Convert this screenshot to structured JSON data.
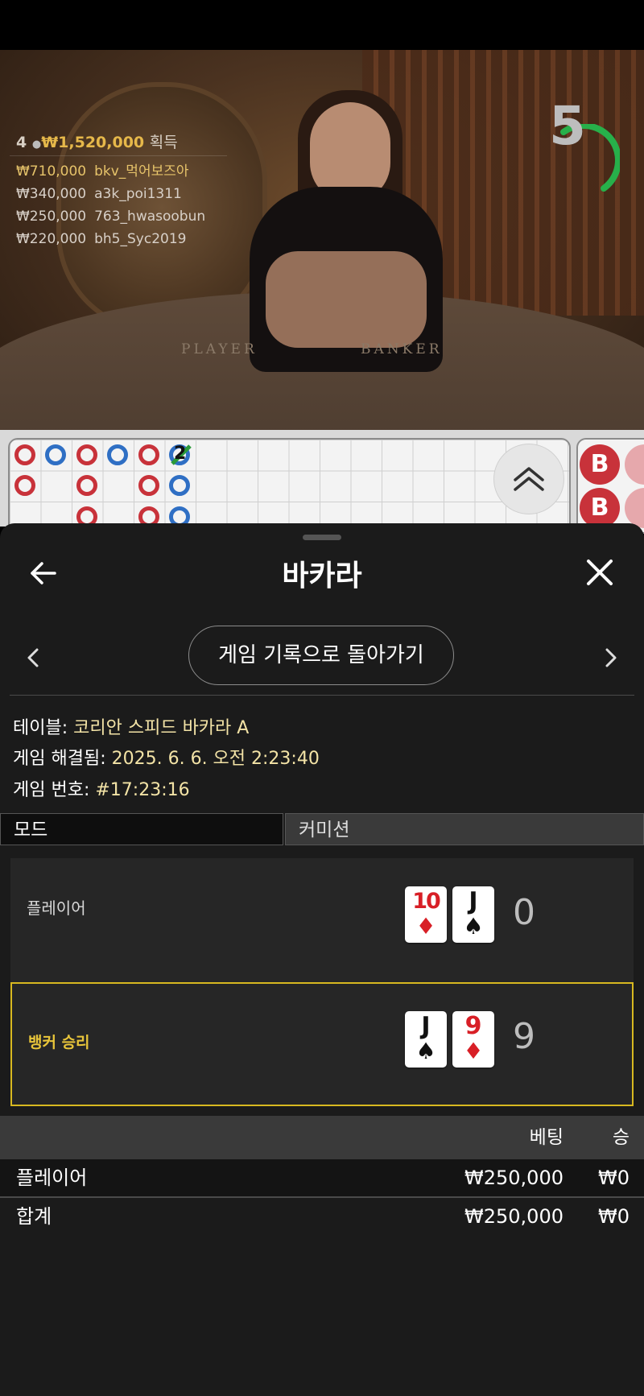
{
  "video": {
    "leaderboard": {
      "winner_count": "4",
      "total_amount": "₩1,520,000",
      "won_label": "획득",
      "rows": [
        {
          "amount": "₩710,000",
          "user": "bkv_먹어보즈아"
        },
        {
          "amount": "₩340,000",
          "user": "a3k_poi1311"
        },
        {
          "amount": "₩250,000",
          "user": "763_hwasoobun"
        },
        {
          "amount": "₩220,000",
          "user": "bh5_Syc2019"
        }
      ]
    },
    "timer": "5",
    "felt_player": "PLAYER",
    "felt_banker": "BANKER"
  },
  "roadmap": {
    "tie_count": "2",
    "side_bead": "B"
  },
  "sheet": {
    "title": "바카라",
    "back_to_history": "게임 기록으로 돌아가기",
    "table_label": "테이블:",
    "table_value": "코리안 스피드 바카라 A",
    "resolved_label": "게임 해결됨:",
    "resolved_value": "2025. 6. 6. 오전 2:23:40",
    "game_no_label": "게임 번호:",
    "game_no_value": "#17:23:16",
    "mode_label": "모드",
    "mode_value": "커미션",
    "player": {
      "label": "플레이어",
      "cards": [
        {
          "rank": "10",
          "suit": "♦"
        },
        {
          "rank": "J",
          "suit": "♠"
        }
      ],
      "score": "0"
    },
    "banker": {
      "label": "뱅커 승리",
      "cards": [
        {
          "rank": "J",
          "suit": "♠"
        },
        {
          "rank": "9",
          "suit": "♦"
        }
      ],
      "score": "9"
    },
    "bets": {
      "header_bet": "베팅",
      "header_win": "승",
      "rows": [
        {
          "name": "플레이어",
          "bet": "₩250,000",
          "win": "₩0"
        },
        {
          "name": "합계",
          "bet": "₩250,000",
          "win": "₩0"
        }
      ]
    }
  }
}
